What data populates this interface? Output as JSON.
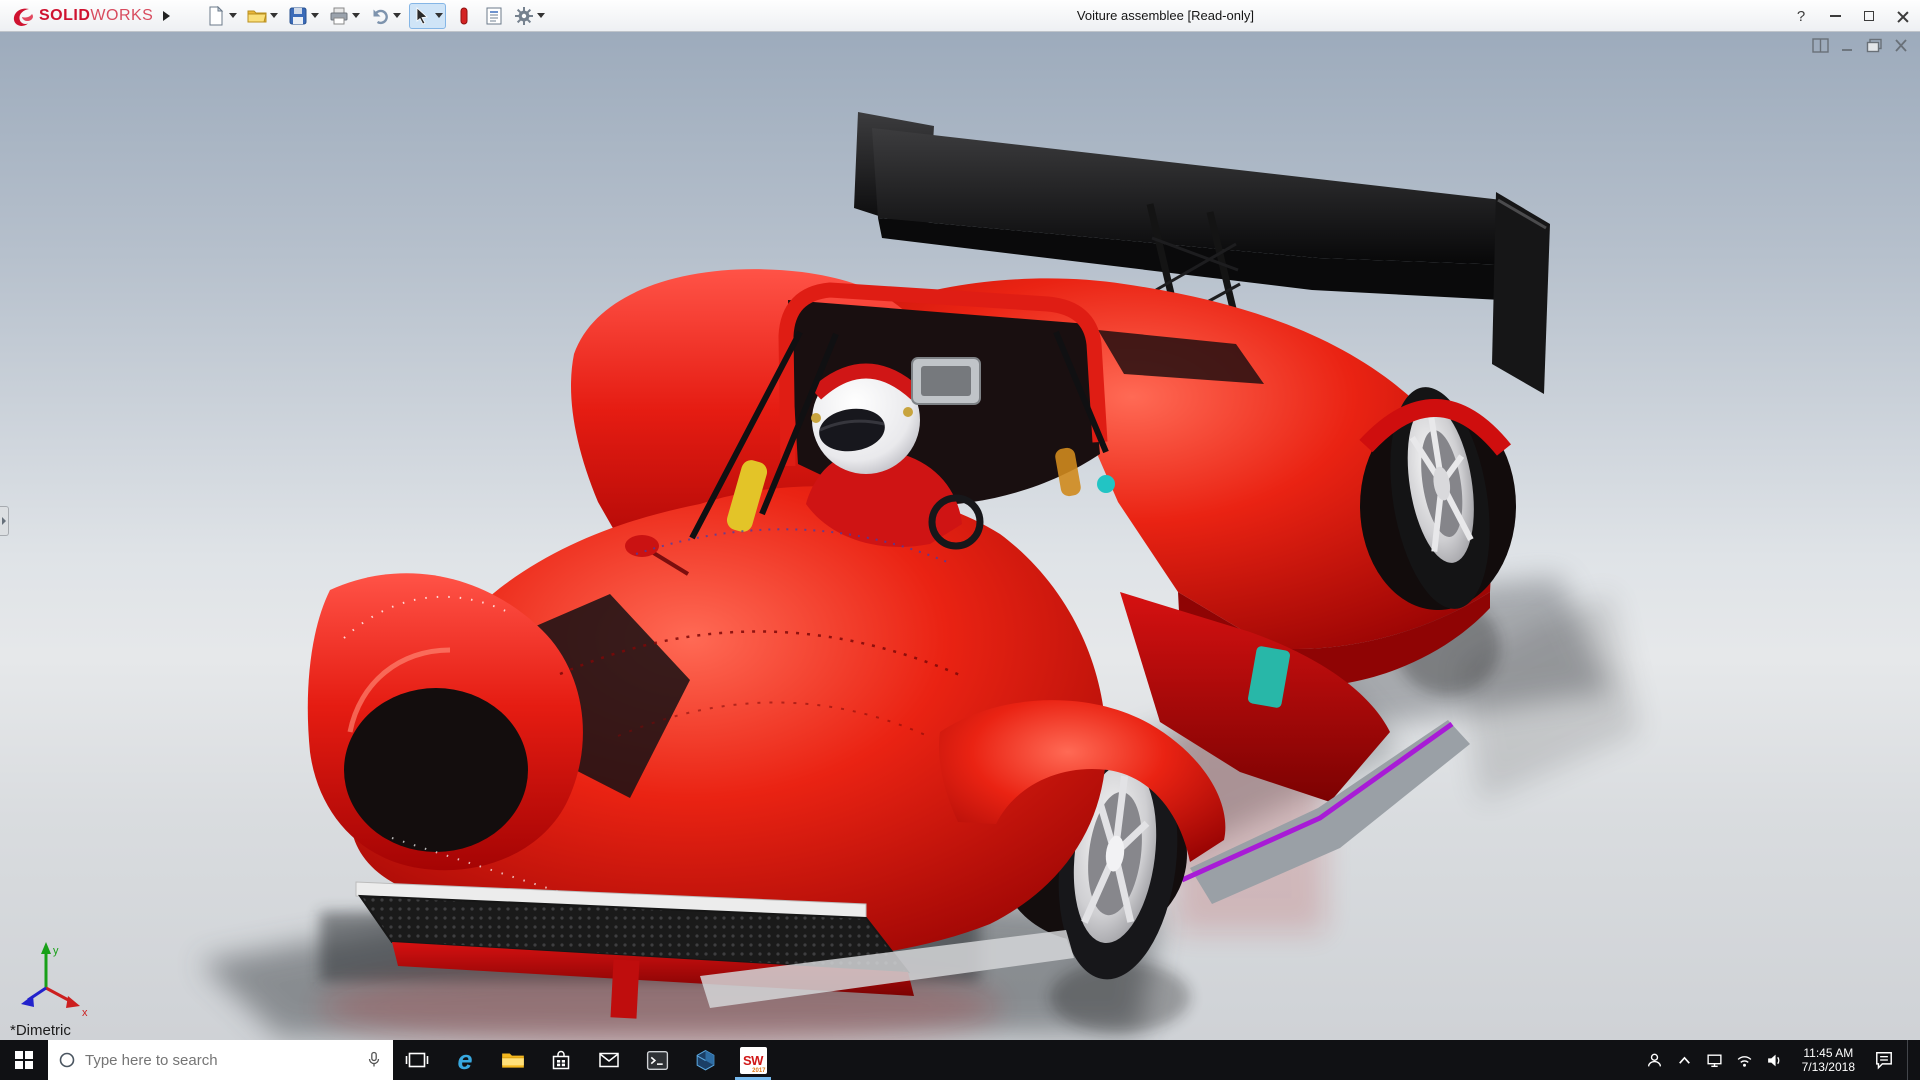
{
  "window": {
    "title": "Voiture assemblee [Read-only]",
    "brand": {
      "logo": "dassault-systemes-logo",
      "name_bold": "SOLID",
      "name_light": "WORKS"
    },
    "controls": {
      "help": "?"
    }
  },
  "toolbar": {
    "items": [
      {
        "name": "new-document",
        "dropdown": true
      },
      {
        "name": "open",
        "dropdown": true
      },
      {
        "name": "save",
        "dropdown": true
      },
      {
        "name": "print",
        "dropdown": true
      },
      {
        "name": "undo",
        "dropdown": true
      },
      {
        "name": "select",
        "dropdown": true,
        "active": true
      },
      {
        "name": "rebuild",
        "dropdown": false
      },
      {
        "name": "file-properties",
        "dropdown": false
      },
      {
        "name": "options",
        "dropdown": true
      }
    ]
  },
  "viewport": {
    "view_label": "*Dimetric",
    "triad": {
      "x": "x",
      "y": "y"
    },
    "corner_controls": [
      "split-pane",
      "minimize-view",
      "restore-view",
      "close-view"
    ],
    "background_top": "#9dabbc",
    "background_bottom": "#cfd2d6"
  },
  "model": {
    "name": "Voiture assemblee",
    "description": "Red open-cockpit prototype race car with helmeted driver, black rear wing, silver wheels, reflective floor",
    "colors": {
      "body_red": "#e31515",
      "body_dark_red": "#8f0404",
      "wing_black": "#101012",
      "accent_purple": "#a81bd6",
      "accent_teal": "#22c4c4",
      "accent_yellow": "#e3c428",
      "rim_silver": "#cfcfd2",
      "helmet_white": "#f2f2f4",
      "splitter_gray": "#9aa0a6"
    }
  },
  "taskbar": {
    "search": {
      "placeholder": "Type here to search"
    },
    "apps": [
      {
        "name": "task-view"
      },
      {
        "name": "microsoft-edge",
        "glyph": "e"
      },
      {
        "name": "file-explorer"
      },
      {
        "name": "microsoft-store"
      },
      {
        "name": "mail"
      },
      {
        "name": "command-prompt"
      },
      {
        "name": "solidworks-composer"
      },
      {
        "name": "solidworks-2017",
        "label": "SW",
        "year": "2017",
        "active": true
      }
    ],
    "tray": [
      "people",
      "hidden-icons",
      "network",
      "wifi",
      "volume"
    ],
    "clock": {
      "time": "11:45 AM",
      "date": "7/13/2018"
    },
    "action_center": "action-center"
  }
}
